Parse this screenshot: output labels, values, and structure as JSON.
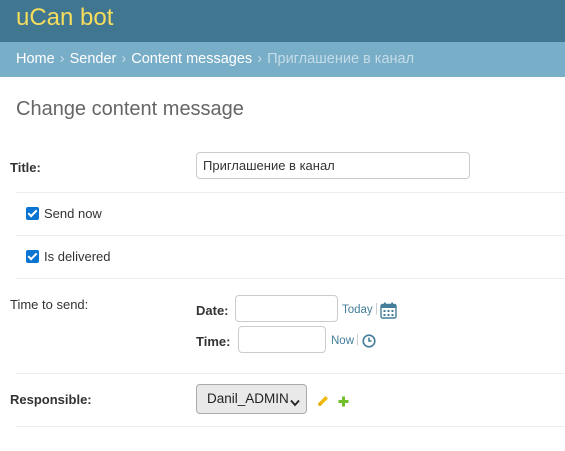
{
  "header": {
    "brand": "uCan bot"
  },
  "breadcrumbs": {
    "items": [
      "Home",
      "Sender",
      "Content messages"
    ],
    "current": "Приглашение в канал",
    "separator": "›"
  },
  "page": {
    "title": "Change content message"
  },
  "form": {
    "title": {
      "label": "Title:",
      "value": "Приглашение в канал"
    },
    "send_now": {
      "label": "Send now",
      "checked": true
    },
    "is_delivered": {
      "label": "Is delivered",
      "checked": true
    },
    "time_to_send": {
      "label": "Time to send:",
      "date_label": "Date:",
      "date_value": "",
      "today_link": "Today",
      "time_label": "Time:",
      "time_value": "",
      "now_link": "Now",
      "calendar_icon": "calendar-icon",
      "clock_icon": "clock-icon"
    },
    "responsible": {
      "label": "Responsible:",
      "selected": "Danil_ADMIN",
      "edit_icon": "pencil-icon",
      "add_icon": "plus-icon"
    }
  },
  "colors": {
    "header_bg": "#417690",
    "brand": "#f5dd5d",
    "breadcrumbs_bg": "#79aec8",
    "link": "#447e9b",
    "checkbox": "#0a74d3",
    "add_icon": "#70bf2b",
    "edit_icon": "#efb80b"
  }
}
